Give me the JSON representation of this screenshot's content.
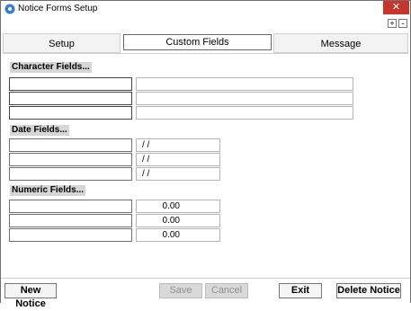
{
  "window": {
    "title": "Notice Forms Setup",
    "close_label": "✕",
    "plus_label": "+",
    "minus_label": "-"
  },
  "tabs": [
    {
      "label": "Setup"
    },
    {
      "label": "Custom Fields"
    },
    {
      "label": "Message"
    }
  ],
  "sections": {
    "character": {
      "label": "Character Fields...",
      "rows": [
        {
          "name": "",
          "value": ""
        },
        {
          "name": "",
          "value": ""
        },
        {
          "name": "",
          "value": ""
        }
      ]
    },
    "date": {
      "label": "Date Fields...",
      "rows": [
        {
          "name": "",
          "value": "/ /"
        },
        {
          "name": "",
          "value": "/ /"
        },
        {
          "name": "",
          "value": "/ /"
        }
      ]
    },
    "numeric": {
      "label": "Numeric Fields...",
      "rows": [
        {
          "name": "",
          "value": "0.00"
        },
        {
          "name": "",
          "value": "0.00"
        },
        {
          "name": "",
          "value": "0.00"
        }
      ]
    }
  },
  "buttons": {
    "new_notice": "New Notice",
    "save": "Save",
    "cancel": "Cancel",
    "exit": "Exit",
    "delete_notice": "Delete Notice"
  }
}
